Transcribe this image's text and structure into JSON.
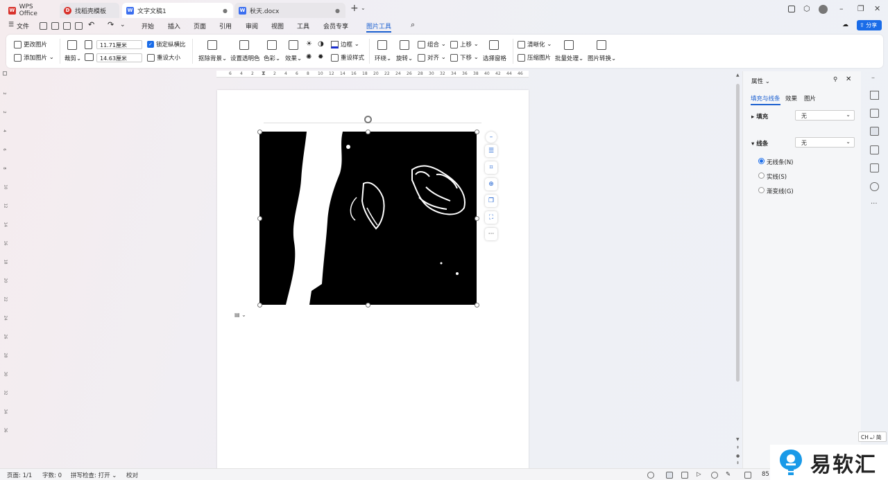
{
  "tabs": [
    {
      "label": "WPS Office",
      "badge": "W",
      "badge_color": "#d8322c",
      "active": false
    },
    {
      "label": "找稻壳模板",
      "badge": "D",
      "badge_color": "#d8322c",
      "active": false
    },
    {
      "label": "文字文稿1",
      "badge": "W",
      "badge_color": "#3b6ef0",
      "active": true
    },
    {
      "label": "秋天.docx",
      "badge": "W",
      "badge_color": "#3b6ef0",
      "active": false
    }
  ],
  "menu": {
    "file": "文件",
    "items": [
      "开始",
      "插入",
      "页面",
      "引用",
      "审阅",
      "视图",
      "工具",
      "会员专享",
      "图片工具"
    ],
    "active": "图片工具",
    "share": "分享"
  },
  "ribbon": {
    "change_image": "更改图片",
    "add_image": "添加图片",
    "crop": "裁剪",
    "width": "11.71厘米",
    "height": "14.63厘米",
    "lock_ratio": "锁定纵横比",
    "reset_size": "重设大小",
    "remove_bg": "抠除背景",
    "set_transparent": "设置透明色",
    "color": "色彩",
    "effects": "效果",
    "border": "边框",
    "reset_style": "重设样式",
    "wrap": "环绕",
    "rotate": "旋转",
    "group": "组合",
    "align": "对齐",
    "bring_forward": "上移",
    "send_backward": "下移",
    "selection_pane": "选择窗格",
    "sharpen": "清晰化",
    "compress": "压缩图片",
    "batch": "批量处理",
    "convert": "图片转换"
  },
  "ruler": {
    "h_ticks": [
      "6",
      "4",
      "2",
      "2",
      "4",
      "6",
      "8",
      "10",
      "12",
      "14",
      "16",
      "18",
      "20",
      "22",
      "24",
      "26",
      "28",
      "30",
      "32",
      "34",
      "36",
      "38",
      "40",
      "42",
      "44",
      "46"
    ],
    "v_ticks": [
      "2",
      "2",
      "4",
      "6",
      "8",
      "10",
      "12",
      "14",
      "16",
      "18",
      "20",
      "22",
      "24",
      "26",
      "28",
      "30",
      "32",
      "34",
      "36"
    ]
  },
  "panel": {
    "title": "属性",
    "tabs": [
      "填充与线条",
      "效果",
      "图片"
    ],
    "fill_label": "填充",
    "fill_value": "无",
    "line_label": "线条",
    "line_value": "无",
    "radios": [
      "无线条(N)",
      "实线(S)",
      "渐变线(G)"
    ]
  },
  "status": {
    "page": "页面: 1/1",
    "words": "字数: 0",
    "spell": "拼写检查: 打开",
    "proof": "校对",
    "zoom": "85"
  },
  "ime": "CH ⤾ 简",
  "watermark": "易软汇"
}
